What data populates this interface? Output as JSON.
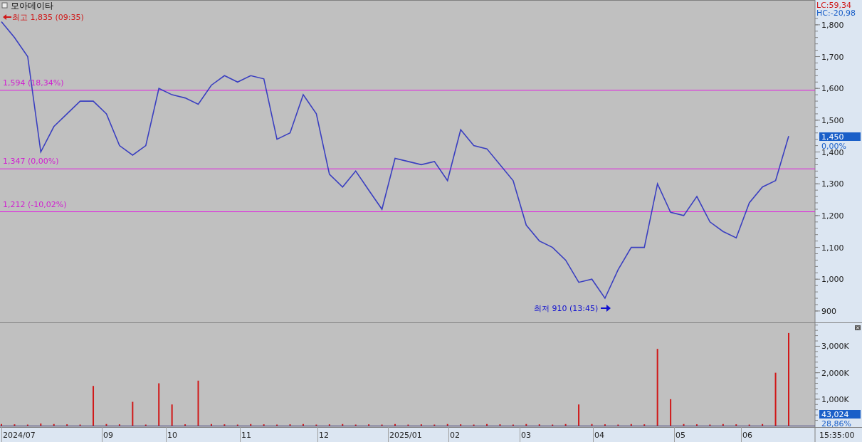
{
  "title": "모아데이타",
  "indicators": [
    {
      "label": "LC:59,34",
      "color": "#d01818"
    },
    {
      "label": "HC:-20,98",
      "color": "#1a5fc8"
    }
  ],
  "price_chart": {
    "high_marker": "최고 1,835 (09:35)",
    "low_marker": "최저 910 (13:45)",
    "last_price": "1,450",
    "last_change": "0,00%",
    "chart_data": {
      "type": "line",
      "series": [
        {
          "color": "#3a3fc0",
          "values": [
            1810,
            1760,
            1700,
            1400,
            1480,
            1520,
            1560,
            1560,
            1520,
            1420,
            1390,
            1420,
            1600,
            1580,
            1570,
            1550,
            1610,
            1640,
            1620,
            1640,
            1630,
            1440,
            1460,
            1580,
            1520,
            1330,
            1290,
            1340,
            1280,
            1220,
            1380,
            1370,
            1360,
            1370,
            1310,
            1470,
            1420,
            1410,
            1360,
            1310,
            1170,
            1120,
            1100,
            1060,
            990,
            1000,
            940,
            1030,
            1100,
            1100,
            1300,
            1210,
            1200,
            1260,
            1180,
            1150,
            1130,
            1240,
            1290,
            1310,
            1450
          ]
        }
      ],
      "ylim": [
        864,
        1878
      ],
      "yticks": [
        {
          "value": 900,
          "label": "900"
        },
        {
          "value": 1000,
          "label": "1,000"
        },
        {
          "value": 1100,
          "label": "1,100"
        },
        {
          "value": 1200,
          "label": "1,200"
        },
        {
          "value": 1300,
          "label": "1,300"
        },
        {
          "value": 1400,
          "label": "1,400"
        },
        {
          "value": 1500,
          "label": "1,500"
        },
        {
          "value": 1600,
          "label": "1,600"
        },
        {
          "value": 1700,
          "label": "1,700"
        },
        {
          "value": 1800,
          "label": "1,800"
        }
      ],
      "ref_lines": [
        {
          "axis": "y",
          "value": 1594,
          "label": "1,594 (18,34%)"
        },
        {
          "axis": "y",
          "value": 1347,
          "label": "1,347 (0,00%)"
        },
        {
          "axis": "y",
          "value": 1212,
          "label": "1,212 (-10,02%)"
        }
      ]
    }
  },
  "volume_chart": {
    "last_volume": "43,024",
    "last_ratio": "28,86%",
    "chart_data": {
      "type": "bar",
      "series": [
        {
          "color": "#d01818",
          "values": [
            60,
            50,
            40,
            80,
            60,
            50,
            40,
            1500,
            60,
            50,
            900,
            40,
            1600,
            800,
            50,
            1700,
            60,
            50,
            40,
            60,
            50,
            40,
            50,
            60,
            40,
            50,
            60,
            40,
            50,
            40,
            60,
            40,
            50,
            40,
            60,
            50,
            40,
            60,
            50,
            40,
            60,
            50,
            40,
            60,
            800,
            60,
            50,
            40,
            60,
            50,
            2900,
            1000,
            60,
            50,
            40,
            60,
            50,
            40,
            60,
            2000,
            3500
          ]
        }
      ],
      "ylim": [
        0,
        3900
      ],
      "yticks": [
        {
          "value": 1000,
          "label": "1,000K"
        },
        {
          "value": 2000,
          "label": "2,000K"
        },
        {
          "value": 3000,
          "label": "3,000K"
        }
      ]
    }
  },
  "time_axis": [
    "2024/07",
    "09",
    "10",
    "11",
    "12",
    "2025/01",
    "02",
    "03",
    "04",
    "05",
    "06"
  ],
  "time": "15:35:00"
}
